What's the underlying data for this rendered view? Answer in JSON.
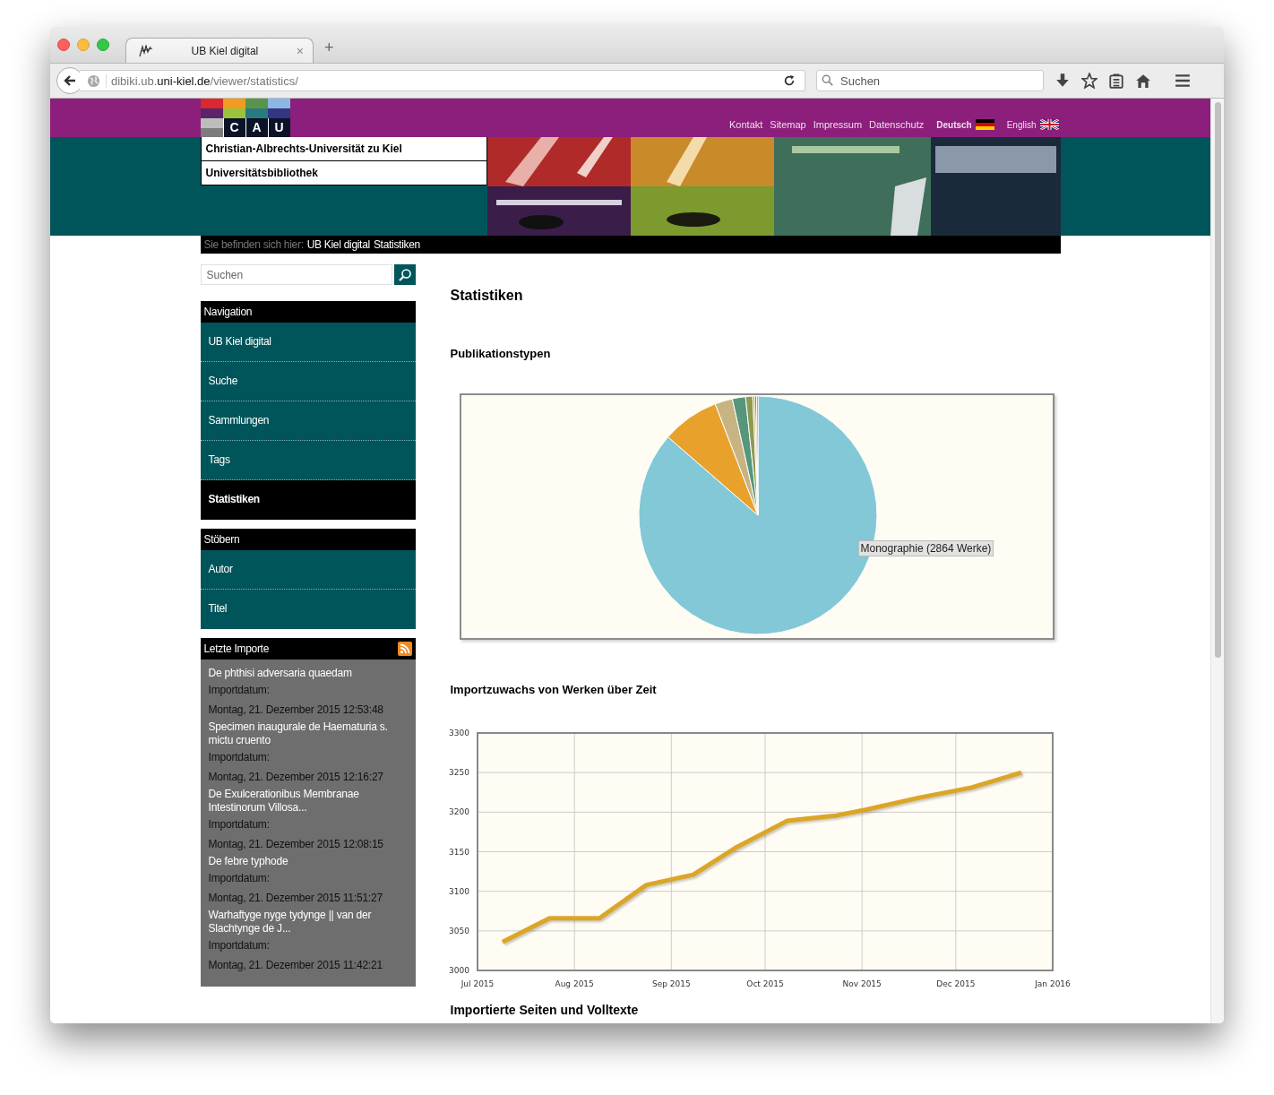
{
  "browser": {
    "tab_title": "UB Kiel digital",
    "tab_close": "×",
    "new_tab": "+",
    "url": {
      "subdomain": "dibiki.ub.",
      "domain": "uni-kiel.de",
      "path": "/viewer/statistics/"
    },
    "search_placeholder": "Suchen"
  },
  "header": {
    "logo_letters": [
      "C",
      "A",
      "U"
    ],
    "top_links": [
      "Kontakt",
      "Sitemap",
      "Impressum",
      "Datenschutz"
    ],
    "languages": [
      {
        "label": "Deutsch",
        "kind": "de",
        "selected": true
      },
      {
        "label": "English",
        "kind": "gb",
        "selected": false
      }
    ],
    "institution": [
      "Christian-Albrechts-Universität zu Kiel",
      "Universitätsbibliothek"
    ]
  },
  "breadcrumb": {
    "prefix": "Sie befinden sich hier:",
    "items": [
      "UB Kiel digital",
      "Statistiken"
    ]
  },
  "sidebar": {
    "search_placeholder": "Suchen",
    "sections": [
      {
        "title": "Navigation",
        "items": [
          {
            "label": "UB Kiel digital",
            "selected": false
          },
          {
            "label": "Suche",
            "selected": false
          },
          {
            "label": "Sammlungen",
            "selected": false
          },
          {
            "label": "Tags",
            "selected": false
          },
          {
            "label": "Statistiken",
            "selected": true
          }
        ]
      },
      {
        "title": "Stöbern",
        "items": [
          {
            "label": "Autor",
            "selected": false
          },
          {
            "label": "Titel",
            "selected": false
          }
        ]
      }
    ],
    "recent": {
      "title": "Letzte Importe",
      "entries": [
        {
          "title": "De phthisi adversaria quaedam",
          "date_label": "Importdatum:",
          "date": "Montag, 21. Dezember 2015 12:53:48"
        },
        {
          "title": "Specimen inaugurale de Haematuria s. mictu cruento",
          "date_label": "Importdatum:",
          "date": "Montag, 21. Dezember 2015 12:16:27"
        },
        {
          "title": "De Exulcerationibus Membranae Intestinorum Villosa...",
          "date_label": "Importdatum:",
          "date": "Montag, 21. Dezember 2015 12:08:15"
        },
        {
          "title": "De febre typhode",
          "date_label": "Importdatum:",
          "date": "Montag, 21. Dezember 2015 11:51:27"
        },
        {
          "title": "Warhaftyge nyge tydynge || van der Slachtynge de J...",
          "date_label": "Importdatum:",
          "date": "Montag, 21. Dezember 2015 11:42:21"
        }
      ]
    }
  },
  "main": {
    "title": "Statistiken",
    "pie_section": {
      "heading": "Publikationstypen",
      "tooltip": "Monographie (2864 Werke)"
    },
    "line_section": {
      "heading": "Importzuwachs von Werken über Zeit",
      "chart_data": {
        "type": "line",
        "x": [
          "2015-07-09",
          "2015-07-24",
          "2015-08-09",
          "2015-08-24",
          "2015-09-08",
          "2015-09-22",
          "2015-10-08",
          "2015-10-24",
          "2015-11-02",
          "2015-11-19",
          "2015-12-06",
          "2015-12-22"
        ],
        "grid": true,
        "series": [
          {
            "color": "#dba628",
            "values": [
              3036,
              3066,
              3066,
              3108,
              3121,
              3156,
              3189,
              3196,
              3203,
              3218,
              3231,
              3250
            ]
          }
        ],
        "xlim": [
          "2015-07-01",
          "2016-01-01"
        ],
        "ylim": [
          3000,
          3300
        ],
        "xticks": [
          {
            "value": "2015-07-01",
            "label": "Jul 2015"
          },
          {
            "value": "2015-08-01",
            "label": "Aug 2015"
          },
          {
            "value": "2015-09-01",
            "label": "Sep 2015"
          },
          {
            "value": "2015-10-01",
            "label": "Oct 2015"
          },
          {
            "value": "2015-11-01",
            "label": "Nov 2015"
          },
          {
            "value": "2015-12-01",
            "label": "Dec 2015"
          },
          {
            "value": "2016-01-01",
            "label": "Jan 2016"
          }
        ],
        "yticks": [
          3000,
          3050,
          3100,
          3150,
          3200,
          3250,
          3300
        ]
      }
    },
    "next_heading": "Importierte Seiten und Volltexte"
  }
}
